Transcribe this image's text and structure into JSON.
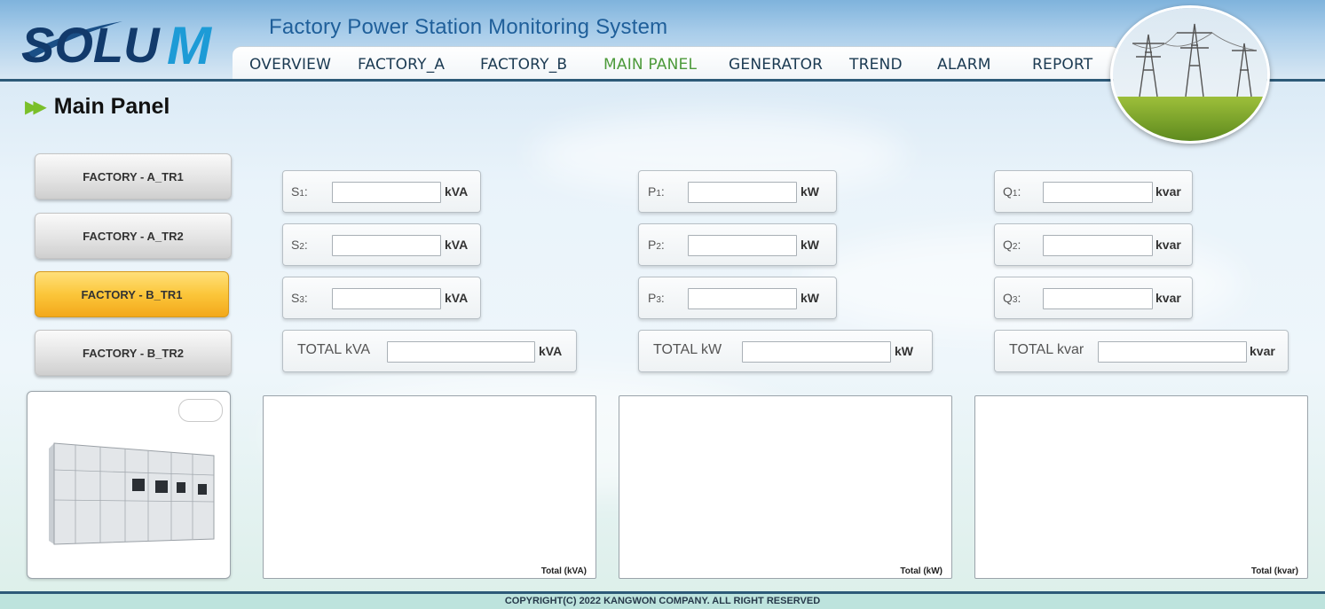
{
  "header": {
    "logo_text": "SOLU M",
    "app_title": "Factory Power Station Monitoring System",
    "nav": [
      "OVERVIEW",
      "FACTORY_A",
      "FACTORY_B",
      "MAIN PANEL",
      "GENERATOR",
      "TREND",
      "ALARM",
      "REPORT"
    ],
    "active_nav": "MAIN PANEL"
  },
  "page_title": "Main Panel",
  "sidebar": {
    "buttons": [
      "FACTORY - A_TR1",
      "FACTORY - A_TR2",
      "FACTORY - B_TR1",
      "FACTORY - B_TR2"
    ],
    "active": "FACTORY - B_TR1"
  },
  "apparent": {
    "rows": [
      {
        "letter": "S",
        "sub": "1",
        "suffix": ":",
        "value": "",
        "unit": "kVA"
      },
      {
        "letter": "S",
        "sub": "2",
        "suffix": ":",
        "value": "",
        "unit": "kVA"
      },
      {
        "letter": "S",
        "sub": "3",
        "suffix": ":",
        "value": "",
        "unit": "kVA"
      }
    ],
    "total_label": "TOTAL kVA",
    "total_value": "",
    "total_unit": "kVA",
    "chart_caption": "Total (kVA)"
  },
  "active_power": {
    "rows": [
      {
        "letter": "P",
        "sub": "1",
        "suffix": ":",
        "value": "",
        "unit": "kW"
      },
      {
        "letter": "P",
        "sub": "2",
        "suffix": ":",
        "value": "",
        "unit": "kW"
      },
      {
        "letter": "P",
        "sub": "3",
        "suffix": ":",
        "value": "",
        "unit": "kW"
      }
    ],
    "total_label": "TOTAL kW",
    "total_value": "",
    "total_unit": "kW",
    "chart_caption": "Total (kW)"
  },
  "reactive": {
    "rows": [
      {
        "letter": "Q",
        "sub": "1",
        "suffix": ":",
        "value": "",
        "unit": "kvar"
      },
      {
        "letter": "Q",
        "sub": "2",
        "suffix": ":",
        "value": "",
        "unit": "kvar"
      },
      {
        "letter": "Q",
        "sub": "3",
        "suffix": ":",
        "value": "",
        "unit": "kvar"
      }
    ],
    "total_label": "TOTAL kvar",
    "total_value": "",
    "total_unit": "kvar",
    "chart_caption": "Total (kvar)"
  },
  "footer": "COPYRIGHT(C) 2022 KANGWON COMPANY. ALL RIGHT RESERVED",
  "colors": {
    "accent_active_nav": "#4c9a3a",
    "active_button": "#fbc63a",
    "title_blue": "#1f5f9a"
  },
  "icons": {
    "title_marker": "double-arrow-icon",
    "header_photo": "power-tower-photo",
    "panel_photo": "switchgear-panel-photo"
  }
}
